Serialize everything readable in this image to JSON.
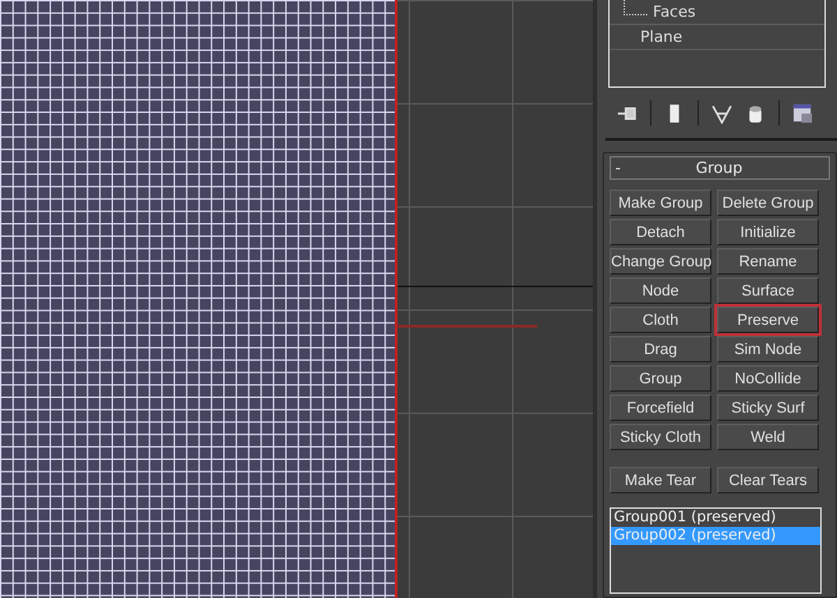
{
  "tree": {
    "items": [
      {
        "label": "Faces",
        "depth_line": true
      },
      {
        "label": "Plane",
        "depth_line": false
      }
    ]
  },
  "rollout": {
    "collapse": "-",
    "title": "Group",
    "buttons": [
      {
        "label": "Make Group",
        "highlighted": false
      },
      {
        "label": "Delete Group",
        "highlighted": false
      },
      {
        "label": "Detach",
        "highlighted": false
      },
      {
        "label": "Initialize",
        "highlighted": false
      },
      {
        "label": "Change Group",
        "highlighted": false
      },
      {
        "label": "Rename",
        "highlighted": false
      },
      {
        "label": "Node",
        "highlighted": false
      },
      {
        "label": "Surface",
        "highlighted": false
      },
      {
        "label": "Cloth",
        "highlighted": false
      },
      {
        "label": "Preserve",
        "highlighted": true
      },
      {
        "label": "Drag",
        "highlighted": false
      },
      {
        "label": "Sim Node",
        "highlighted": false
      },
      {
        "label": "Group",
        "highlighted": false
      },
      {
        "label": "NoCollide",
        "highlighted": false
      },
      {
        "label": "Forcefield",
        "highlighted": false
      },
      {
        "label": "Sticky Surf",
        "highlighted": false
      },
      {
        "label": "Sticky Cloth",
        "highlighted": false
      },
      {
        "label": "Weld",
        "highlighted": false
      }
    ],
    "tear_buttons": [
      {
        "label": "Make Tear"
      },
      {
        "label": "Clear Tears"
      }
    ],
    "groups": [
      {
        "label": "Group001 (preserved)",
        "selected": false
      },
      {
        "label": "Group002 (preserved)",
        "selected": true
      }
    ]
  }
}
